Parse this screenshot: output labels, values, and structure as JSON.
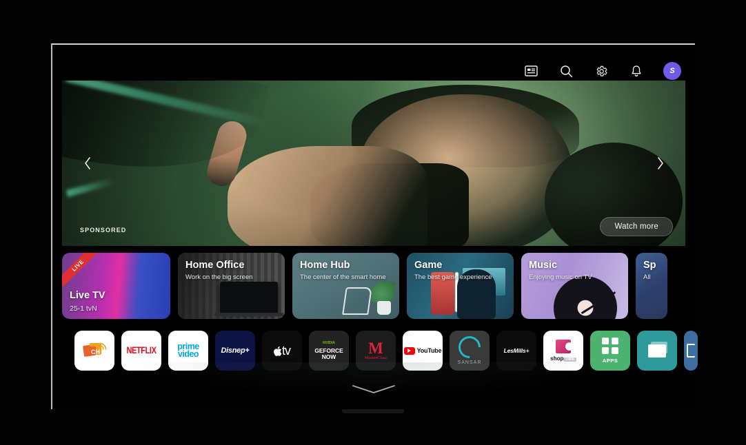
{
  "header": {
    "icons": [
      {
        "name": "guide-icon",
        "label": "Guide"
      },
      {
        "name": "search-icon",
        "label": "Search"
      },
      {
        "name": "settings-icon",
        "label": "Settings"
      },
      {
        "name": "notifications-icon",
        "label": "Notifications"
      }
    ],
    "avatar_initial": "S"
  },
  "hero": {
    "sponsored_label": "SPONSORED",
    "watch_more_label": "Watch more",
    "prev_label": "‹",
    "next_label": "›"
  },
  "cards": [
    {
      "title": "Live TV",
      "subtitle": "25-1  tvN",
      "badge": "LIVE"
    },
    {
      "title": "Home Office",
      "subtitle": "Work on the big screen"
    },
    {
      "title": "Home Hub",
      "subtitle": "The center of the smart home"
    },
    {
      "title": "Game",
      "subtitle": "The best game experience"
    },
    {
      "title": "Music",
      "subtitle": "Enjoying music on TV"
    },
    {
      "title": "Sp",
      "subtitle": "All"
    }
  ],
  "apps": [
    {
      "name": "channel-app",
      "label": "CH"
    },
    {
      "name": "netflix-app",
      "label": "NETFLIX"
    },
    {
      "name": "prime-video-app",
      "label_top": "prime",
      "label_bottom": "video"
    },
    {
      "name": "disney-plus-app",
      "label": "Disnep+"
    },
    {
      "name": "apple-tv-app",
      "label": "tv"
    },
    {
      "name": "geforce-now-app",
      "brand": "NVIDIA",
      "label_top": "GEFORCE",
      "label_bottom": "NOW"
    },
    {
      "name": "masterclass-app",
      "mark": "M",
      "label": "MasterClass"
    },
    {
      "name": "youtube-app",
      "label": "YouTube"
    },
    {
      "name": "sansar-app",
      "label": "SANSAR"
    },
    {
      "name": "lesmills-app",
      "label": "LesMills+"
    },
    {
      "name": "shoptime-app",
      "label": "shop",
      "tag": "TIME"
    },
    {
      "name": "apps-launcher",
      "label": "APPS"
    },
    {
      "name": "screen-share-app",
      "label": ""
    },
    {
      "name": "more-apps",
      "label": ""
    }
  ],
  "footer": {
    "expand_label": "Expand"
  },
  "colors": {
    "accent": "#6c5ce7",
    "live_badge": "#e03030",
    "apps_green": "#4cb370"
  }
}
